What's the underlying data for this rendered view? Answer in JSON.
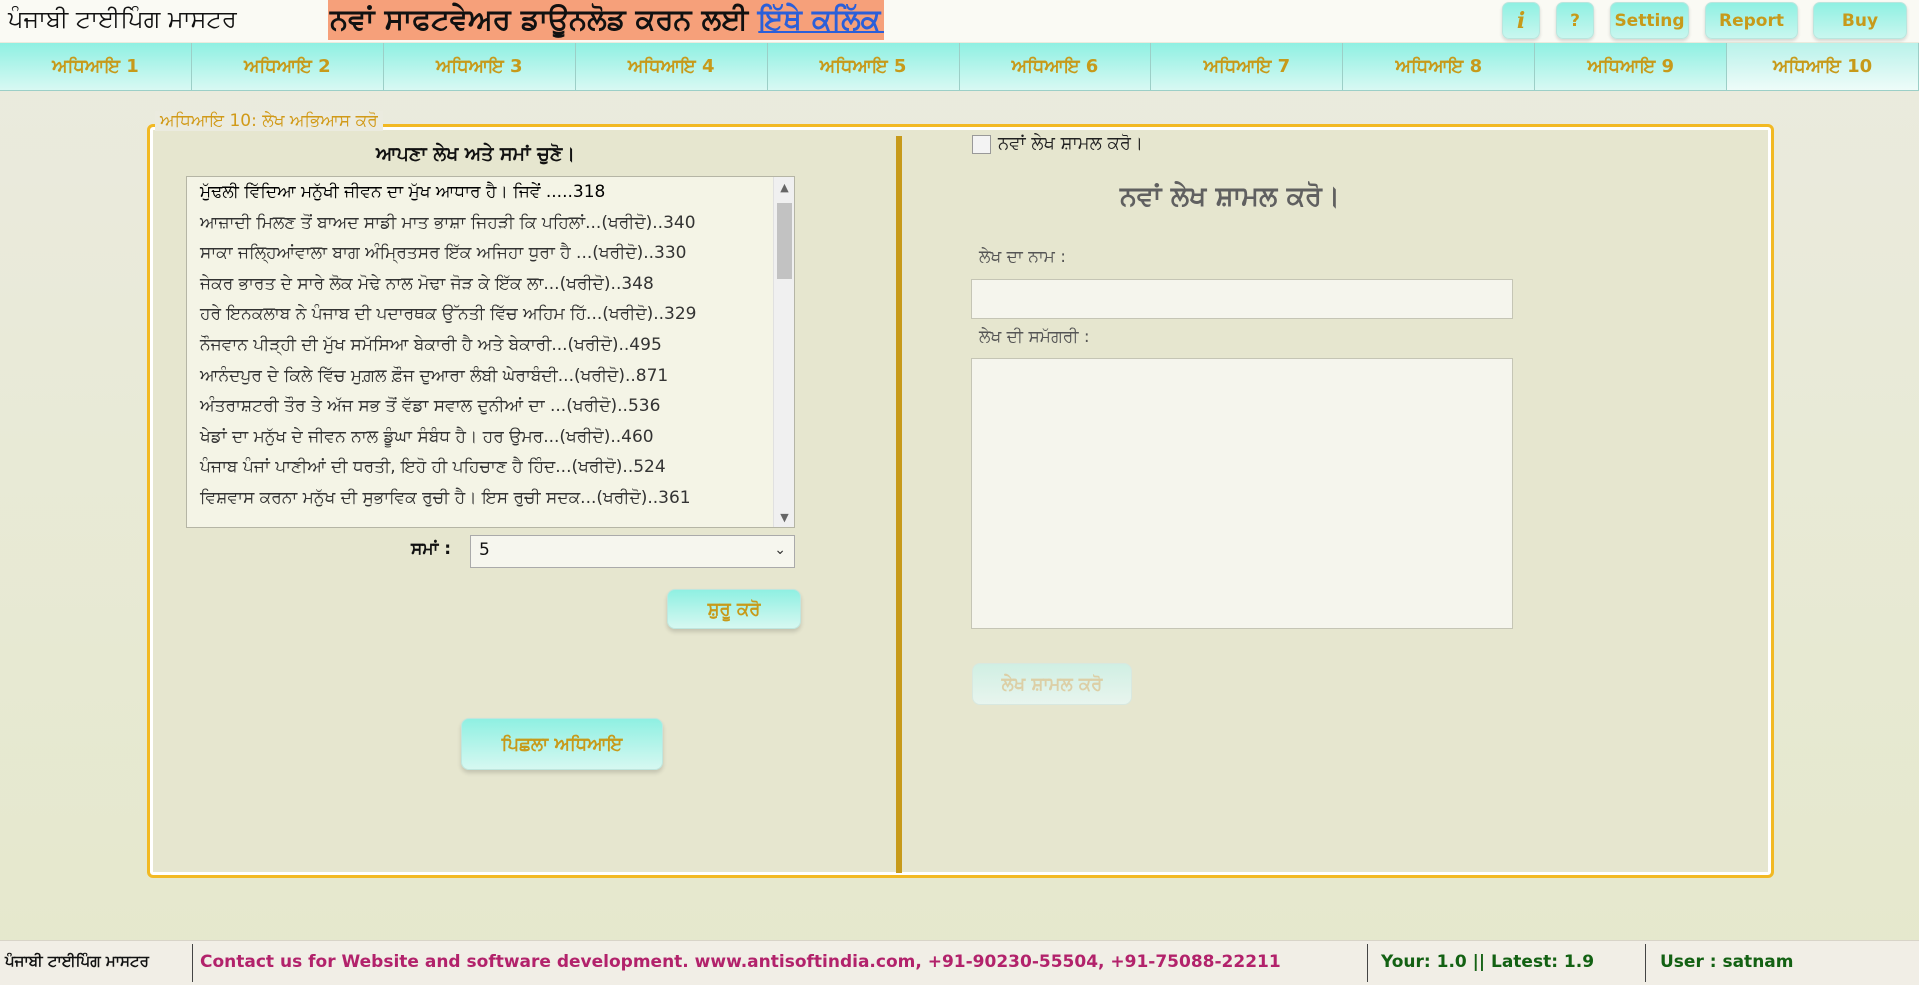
{
  "header": {
    "app_title": "ਪੰਜਾਬੀ ਟਾਈਪਿੰਗ ਮਾਸਟਰ",
    "promo_text": "ਨਵਾਂ ਸਾਫਟਵੇਅਰ ਡਾਊਨਲੋਡ ਕਰਨ ਲਈ",
    "promo_link": "ਇੱਥੇ ਕਲਿੱਕ ਕਰੋ",
    "buttons": {
      "info": "i",
      "help": "?",
      "setting": "Setting",
      "report": "Report",
      "buy": "Buy"
    }
  },
  "tabs": [
    {
      "label": "ਅਧਿਆਇ 1"
    },
    {
      "label": "ਅਧਿਆਇ 2"
    },
    {
      "label": "ਅਧਿਆਇ 3"
    },
    {
      "label": "ਅਧਿਆਇ 4"
    },
    {
      "label": "ਅਧਿਆਇ 5"
    },
    {
      "label": "ਅਧਿਆਇ 6"
    },
    {
      "label": "ਅਧਿਆਇ 7"
    },
    {
      "label": "ਅਧਿਆਇ 8"
    },
    {
      "label": "ਅਧਿਆਇ 9"
    },
    {
      "label": "ਅਧਿਆਇ 10"
    }
  ],
  "panel": {
    "legend": "ਅਧਿਆਇ 10: ਲੇਖ ਅਭਿਆਸ ਕਰੋ",
    "choose_title": "ਆਪਣਾ ਲੇਖ ਅਤੇ ਸਮਾਂ ਚੁਣੋ।",
    "essays": [
      "ਮੁੱਢਲੀ ਵਿੱਦਿਆ ਮਨੁੱਖੀ ਜੀਵਨ ਦਾ ਮੁੱਖ ਆਧਾਰ ਹੈ। ਜਿਵੇਂ .....318",
      "ਆਜ਼ਾਦੀ ਮਿਲਣ ਤੋਂ ਬਾਅਦ ਸਾਡੀ ਮਾਤ ਭਾਸ਼ਾ ਜਿਹੜੀ ਕਿ ਪਹਿਲਾਂ...(ਖਰੀਦੋ)..340",
      "ਸਾਕਾ ਜਲ੍ਹਿਆਂਵਾਲਾ ਬਾਗ ਅੰਮ੍ਰਿਤਸਰ ਇੱਕ ਅਜਿਹਾ ਧੁਰਾ ਹੈ ...(ਖਰੀਦੋ)..330",
      "ਜੇਕਰ ਭਾਰਤ ਦੇ ਸਾਰੇ ਲੋਕ ਮੋਢੇ ਨਾਲ ਮੋਢਾ ਜੋੜ ਕੇ ਇੱਕ ਲਾ...(ਖਰੀਦੋ)..348",
      "ਹਰੇ ਇਨਕਲਾਬ ਨੇ ਪੰਜਾਬ ਦੀ ਪਦਾਰਥਕ ਉੱਨਤੀ ਵਿੱਚ ਅਹਿਮ ਹਿੱ...(ਖਰੀਦੋ)..329",
      "ਨੌਜਵਾਨ ਪੀੜ੍ਹੀ ਦੀ ਮੁੱਖ ਸਮੱਸਿਆ ਬੇਕਾਰੀ ਹੈ ਅਤੇ ਬੇਕਾਰੀ...(ਖਰੀਦੋ)..495",
      "ਆਨੰਦਪੁਰ ਦੇ ਕਿਲੇ ਵਿੱਚ ਮੁਗ਼ਲ ਫ਼ੌਜ ਦੁਆਰਾ ਲੰਬੀ ਘੇਰਾਬੰਦੀ...(ਖਰੀਦੋ)..871",
      "ਅੰਤਰਾਸ਼ਟਰੀ ਤੌਰ ਤੇ ਅੱਜ ਸਭ ਤੋਂ ਵੱਡਾ ਸਵਾਲ ਦੁਨੀਆਂ ਦਾ ...(ਖਰੀਦੋ)..536",
      "ਖੇਡਾਂ ਦਾ ਮਨੁੱਖ ਦੇ ਜੀਵਨ ਨਾਲ ਡੂੰਘਾ ਸੰਬੰਧ ਹੈ। ਹਰ ਉਮਰ...(ਖਰੀਦੋ)..460",
      "ਪੰਜਾਬ ਪੰਜਾਂ ਪਾਣੀਆਂ ਦੀ ਧਰਤੀ, ਇਹੋ ਹੀ ਪਹਿਚਾਣ ਹੈ ਹਿੰਦ...(ਖਰੀਦੋ)..524",
      "ਵਿਸ਼ਵਾਸ ਕਰਨਾ ਮਨੁੱਖ ਦੀ ਸੁਭਾਵਿਕ ਰੁਚੀ ਹੈ। ਇਸ ਰੁਚੀ ਸਦਕ...(ਖਰੀਦੋ)..361"
    ],
    "time_label": "ਸਮਾਂ :",
    "time_value": "5",
    "start_button": "ਸ਼ੁਰੂ ਕਰੋ",
    "prev_button": "ਪਿਛਲਾ ਅਧਿਆਇ",
    "add_new_checkbox_label": "ਨਵਾਂ ਲੇਖ ਸ਼ਾਮਲ ਕਰੋ।",
    "add_heading": "ਨਵਾਂ ਲੇਖ ਸ਼ਾਮਲ ਕਰੋ।",
    "essay_name_label": "ਲੇਖ ਦਾ ਨਾਮ :",
    "essay_content_label": "ਲੇਖ ਦੀ ਸਮੱਗਰੀ :",
    "add_essay_button": "ਲੇਖ ਸ਼ਾਮਲ ਕਰੋ"
  },
  "footer": {
    "app_name": "ਪੰਜਾਬੀ ਟਾਈਪਿੰਗ ਮਾਸਟਰ",
    "contact": "Contact us for Website and software development. www.antisoftindia.com, +91-90230-55504, +91-75088-22211",
    "version": "Your: 1.0 || Latest: 1.9",
    "user": "User : satnam"
  },
  "colors": {
    "accent_gold": "#c79a1a",
    "tab_cyan": "#8ff0e2",
    "promo_bg": "#f6a07a",
    "contact_magenta": "#b2226b",
    "footer_green": "#136113"
  }
}
